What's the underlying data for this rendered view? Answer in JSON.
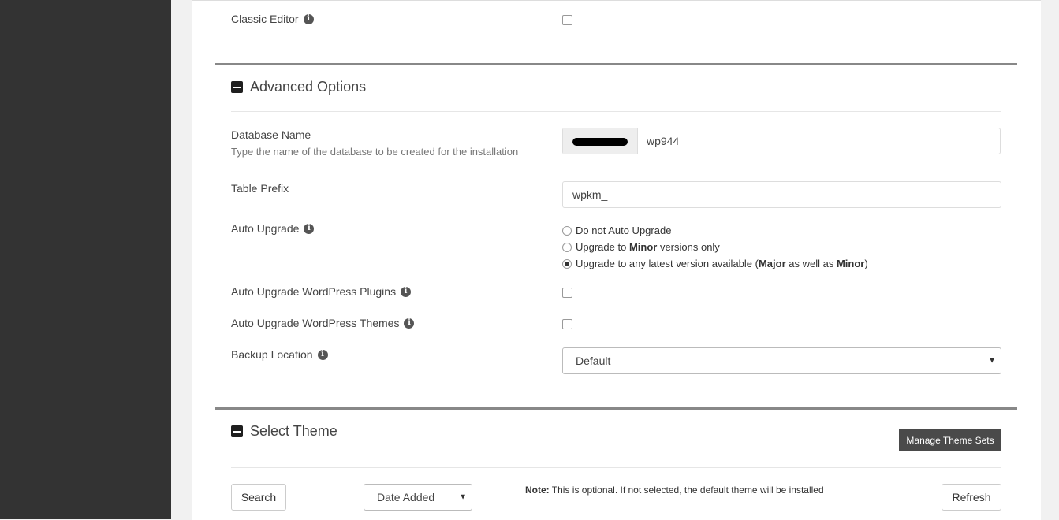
{
  "classic_editor": {
    "label": "Classic Editor",
    "info_icon": "info-icon"
  },
  "advanced_options": {
    "title": "Advanced Options",
    "toggle_icon": "minus-square-icon"
  },
  "database_name": {
    "label": "Database Name",
    "help": "Type the name of the database to be created for the installation",
    "value": "wp944"
  },
  "table_prefix": {
    "label": "Table Prefix",
    "value": "wpkm_"
  },
  "auto_upgrade": {
    "label": "Auto Upgrade",
    "options": [
      {
        "pre": "Do not Auto Upgrade",
        "b1": "",
        "mid": "",
        "b2": "",
        "post": ""
      },
      {
        "pre": "Upgrade to ",
        "b1": "Minor",
        "mid": " versions only",
        "b2": "",
        "post": ""
      },
      {
        "pre": "Upgrade to any latest version available (",
        "b1": "Major",
        "mid": " as well as ",
        "b2": "Minor",
        "post": ")"
      }
    ],
    "selected_index": 2
  },
  "auto_upgrade_plugins": {
    "label": "Auto Upgrade WordPress Plugins"
  },
  "auto_upgrade_themes": {
    "label": "Auto Upgrade WordPress Themes"
  },
  "backup_location": {
    "label": "Backup Location",
    "value": "Default"
  },
  "select_theme": {
    "title": "Select Theme",
    "manage_button": "Manage Theme Sets",
    "search_button": "Search",
    "sort_value": "Date Added",
    "note_label": "Note:",
    "note_text": " This is optional. If not selected, the default theme will be installed",
    "refresh_button": "Refresh"
  },
  "colors": {
    "dark_sidebar": "#333333",
    "button_dark": "#4a4a4a",
    "rule": "#888888"
  }
}
